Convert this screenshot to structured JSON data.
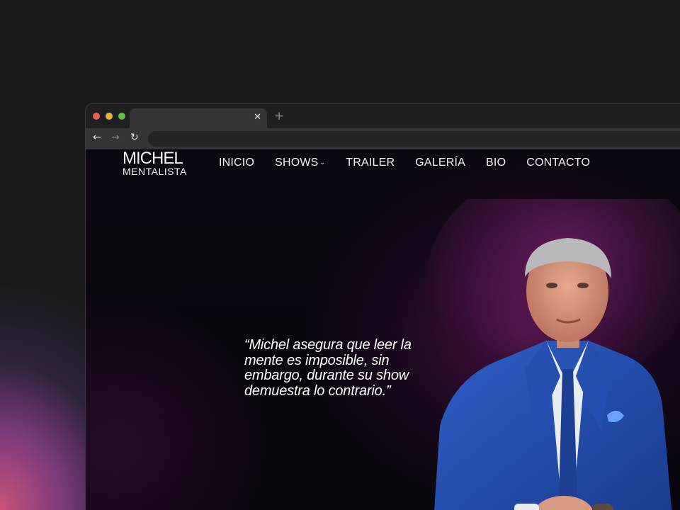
{
  "browser": {
    "tab_close_icon": "close-icon",
    "new_tab_icon": "plus-icon",
    "back_icon": "arrow-left-icon",
    "forward_icon": "arrow-right-icon",
    "reload_icon": "reload-icon",
    "traffic_colors": {
      "close": "#ec5f57",
      "minimize": "#e6b33a",
      "maximize": "#5ec143"
    }
  },
  "site": {
    "logo_line1": "MICHEL",
    "logo_line2": "MENTALISTA",
    "nav": [
      {
        "label": "INICIO"
      },
      {
        "label": "SHOWS",
        "has_dropdown": true
      },
      {
        "label": "TRAILER"
      },
      {
        "label": "GALERÍA"
      },
      {
        "label": "BIO"
      },
      {
        "label": "CONTACTO"
      }
    ],
    "quote": "“Michel asegura que leer la mente es imposible, sin embargo, durante su show demuestra lo contrario.”",
    "hero_image": "man-in-blue-suit-portrait"
  },
  "colors": {
    "page_background": "#1a1a1c",
    "hero_background": "#0a060d",
    "accent_glow": "#c8537a",
    "suit_blue": "#1f4aa8"
  }
}
